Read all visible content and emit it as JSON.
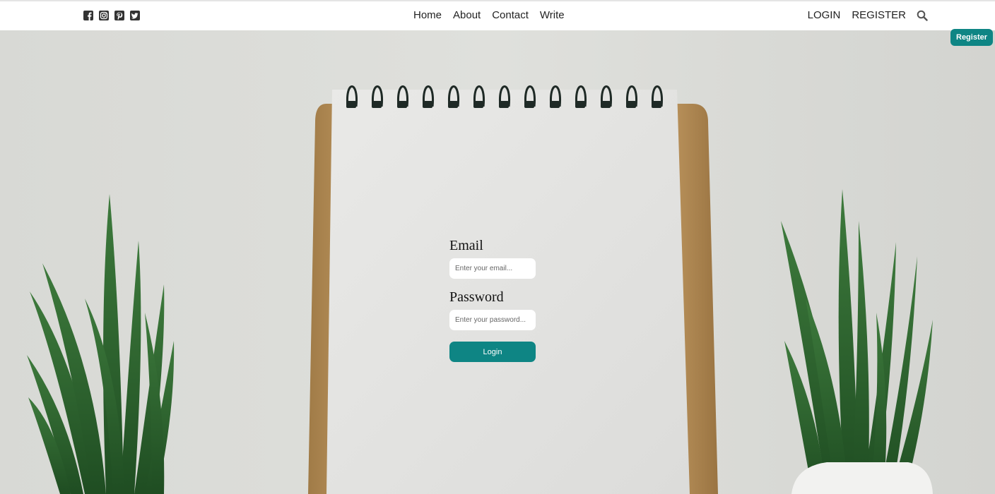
{
  "header": {
    "social_icons": [
      "facebook-square-icon",
      "instagram-icon",
      "pinterest-square-icon",
      "twitter-square-icon"
    ],
    "nav": [
      "Home",
      "About",
      "Contact",
      "Write"
    ],
    "auth": {
      "login": "LOGIN",
      "register": "REGISTER"
    },
    "search_icon": "search-icon"
  },
  "register_badge": "Register",
  "login_form": {
    "email_label": "Email",
    "email_placeholder": "Enter your email...",
    "password_label": "Password",
    "password_placeholder": "Enter your password...",
    "submit_label": "Login"
  },
  "colors": {
    "accent": "#0e8584",
    "header_bg": "#ffffff",
    "text": "#222222"
  }
}
